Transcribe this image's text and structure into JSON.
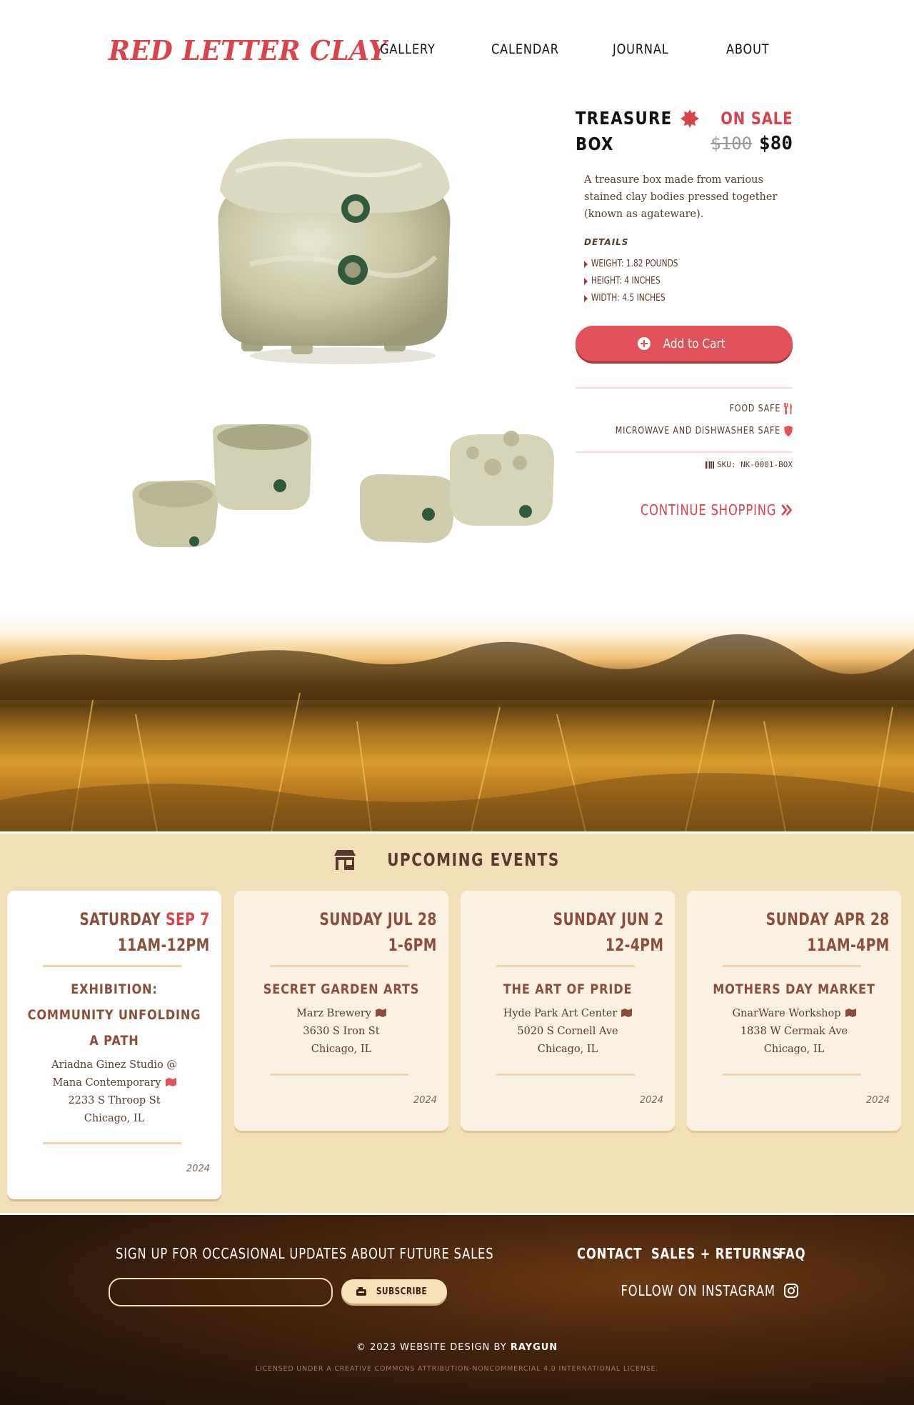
{
  "header": {
    "logo": "RED LETTER CLAY",
    "nav": [
      "GALLERY",
      "CALENDAR",
      "JOURNAL",
      "ABOUT"
    ]
  },
  "product": {
    "title_line1": "TREASURE",
    "title_line2": "BOX",
    "sale_label": "ON SALE",
    "old_price": "$100",
    "new_price": "$80",
    "description": "A treasure box made from various stained clay bodies pressed together (known as agateware).",
    "details_heading": "DETAILS",
    "details": [
      "WEIGHT: 1.82 POUNDS",
      "HEIGHT: 4 INCHES",
      "WIDTH: 4.5 INCHES"
    ],
    "add_to_cart": "Add to Cart",
    "features": [
      "FOOD SAFE",
      "MICROWAVE AND DISHWASHER SAFE"
    ],
    "sku": "SKU: NK-0001-BOX",
    "continue": "CONTINUE SHOPPING",
    "glaze_color": "#c9c7a4",
    "accent_color": "#d9434a"
  },
  "events": {
    "heading": "UPCOMING EVENTS",
    "cards": [
      {
        "day": "SATURDAY",
        "date": "SEP 7",
        "time": "11AM-12PM",
        "title_lines": [
          "EXHIBITION:",
          "COMMUNITY UNFOLDING",
          "A PATH"
        ],
        "address_lines": [
          "Ariadna Ginez Studio @",
          "Mana Contemporary",
          "2233 S Throop St",
          "Chicago, IL"
        ],
        "year": "2024",
        "highlight": true
      },
      {
        "day": "SUNDAY",
        "date": "JUL 28",
        "time": "1-6PM",
        "title_lines": [
          "SECRET GARDEN ARTS"
        ],
        "address_lines": [
          "Marz Brewery",
          "3630 S Iron St",
          "Chicago, IL"
        ],
        "year": "2024",
        "highlight": false
      },
      {
        "day": "SUNDAY",
        "date": "JUN 2",
        "time": "12-4PM",
        "title_lines": [
          "THE ART OF PRIDE"
        ],
        "address_lines": [
          "Hyde Park Art Center",
          "5020 S Cornell Ave",
          "Chicago, IL"
        ],
        "year": "2024",
        "highlight": false
      },
      {
        "day": "SUNDAY",
        "date": "APR 28",
        "time": "11AM-4PM",
        "title_lines": [
          "MOTHERS DAY MARKET"
        ],
        "address_lines": [
          "GnarWare Workshop",
          "1838 W Cermak Ave",
          "Chicago, IL"
        ],
        "year": "2024",
        "highlight": false
      }
    ]
  },
  "footer": {
    "signup": "SIGN UP FOR OCCASIONAL UPDATES ABOUT FUTURE SALES",
    "email_value": "",
    "subscribe": "SUBSCRIBE",
    "links": [
      "CONTACT",
      "SALES + RETURNS",
      "FAQ"
    ],
    "instagram": "FOLLOW ON INSTAGRAM",
    "copyright_prefix": "© 2023 WEBSITE DESIGN BY",
    "copyright_brand": "RAYGUN",
    "license": "LICENSED UNDER A CREATIVE COMMONS ATTRIBUTION-NONCOMMERCIAL 4.0 INTERNATIONAL LICENSE."
  }
}
